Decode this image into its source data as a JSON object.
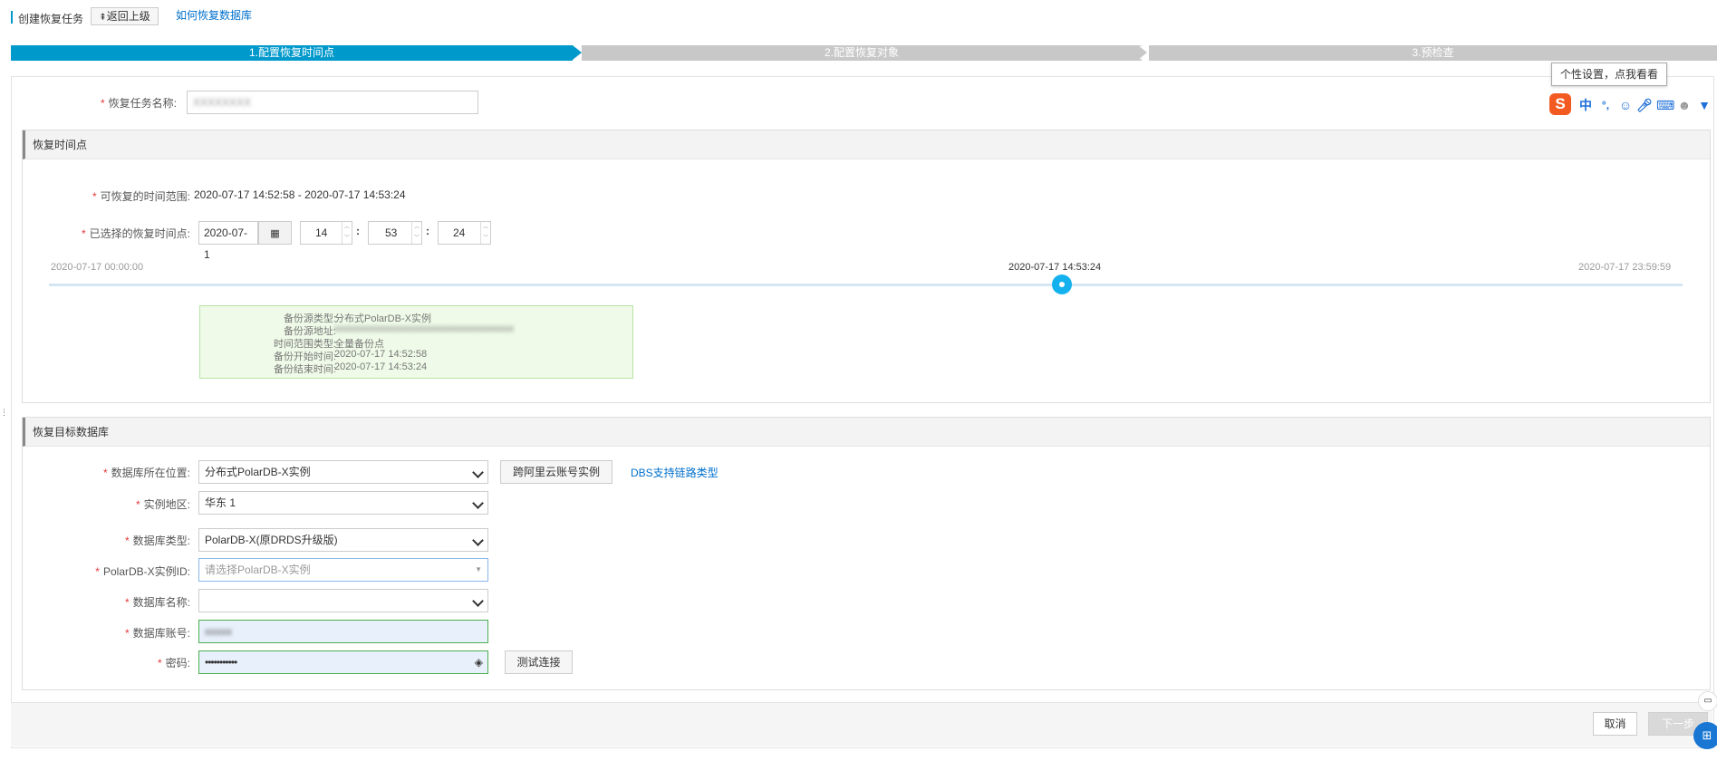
{
  "header": {
    "title": "创建恢复任务",
    "back_label": "返回上级",
    "help_link": "如何恢复数据库"
  },
  "steps": [
    "1.配置恢复时间点",
    "2.配置恢复对象",
    "3.预检查"
  ],
  "task": {
    "name_label": "恢复任务名称:",
    "name_value": "XXXXXXXX"
  },
  "time_section": {
    "title": "恢复时间点",
    "range_label": "可恢复的时间范围:",
    "range_value": "2020-07-17 14:52:58 - 2020-07-17 14:53:24",
    "selected_label": "已选择的恢复时间点:",
    "date_value": "2020-07-1",
    "hour": "14",
    "minute": "53",
    "second": "24",
    "colon": ":",
    "slider_start": "2020-07-17 00:00:00",
    "slider_end": "2020-07-17 23:59:59",
    "slider_current": "2020-07-17 14:53:24",
    "slider_fraction": 0.62
  },
  "info_box": {
    "rows": [
      {
        "label": "备份源类型:",
        "value": "分布式PolarDB-X实例"
      },
      {
        "label": "备份源地址:",
        "value": "xxxxxxxxxxxxxxxxxxxxxxxxxxxxxxxxxxxx"
      },
      {
        "label": "时间范围类型:",
        "value": "全量备份点"
      },
      {
        "label": "备份开始时间:",
        "value": "2020-07-17 14:52:58"
      },
      {
        "label": "备份结束时间:",
        "value": "2020-07-17 14:53:24"
      }
    ]
  },
  "target_section": {
    "title": "恢复目标数据库",
    "location_label": "数据库所在位置:",
    "location_value": "分布式PolarDB-X实例",
    "cross_account_button": "跨阿里云账号实例",
    "dbs_link": "DBS支持链路类型",
    "region_label": "实例地区:",
    "region_value": "华东 1",
    "dbtype_label": "数据库类型:",
    "dbtype_value": "PolarDB-X(原DRDS升级版)",
    "instance_label": "PolarDB-X实例ID:",
    "instance_placeholder": "请选择PolarDB-X实例",
    "dbname_label": "数据库名称:",
    "dbname_value": "",
    "account_label": "数据库账号:",
    "account_value": "xxxxx",
    "password_label": "密码:",
    "password_value": "•••••••••••",
    "test_button": "测试连接"
  },
  "footer": {
    "cancel": "取消",
    "next": "下一步"
  },
  "ime": {
    "tooltip": "个性设置，点我看看",
    "logo": "S",
    "chinese": "中",
    "punct": "°,"
  },
  "colors": {
    "accent": "#0099cc",
    "step_inactive": "#c8c8c8",
    "link": "#0070cc",
    "required": "#e4393c",
    "info_bg": "#effae8",
    "info_border": "#b9e2a6",
    "success_border": "#4caf50"
  }
}
